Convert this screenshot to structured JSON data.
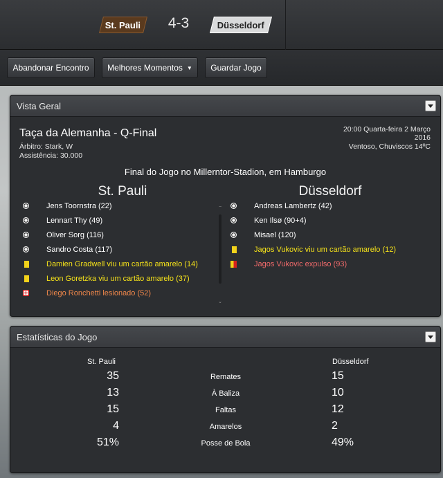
{
  "scoreboard": {
    "home_team": "St. Pauli",
    "score": "4-3",
    "away_team": "Düsseldorf",
    "home_color": "#5a3a1e",
    "away_color": "#d9dadb"
  },
  "toolbar": {
    "abandon_label": "Abandonar Encontro",
    "highlights_label": "Melhores Momentos",
    "save_label": "Guardar Jogo"
  },
  "overview": {
    "title": "Vista Geral",
    "competition": "Taça da Alemanha - Q-Final",
    "referee": "Árbitro: Stark, W",
    "attendance": "Assistência: 30.000",
    "kickoff": "20:00 Quarta-feira 2 Março",
    "year": "2016",
    "weather": "Ventoso, Chuviscos 14ºC",
    "venue": "Final do Jogo no Millerntor-Stadion, em Hamburgo",
    "home_team": "St. Pauli",
    "away_team": "Düsseldorf",
    "home_events": [
      {
        "type": "goal",
        "icon": "ball-icon",
        "text": "Jens Toornstra (22)"
      },
      {
        "type": "goal",
        "icon": "ball-icon",
        "text": "Lennart Thy (49)"
      },
      {
        "type": "goal",
        "icon": "ball-icon",
        "text": "Oliver Sorg (116)"
      },
      {
        "type": "goal",
        "icon": "ball-icon",
        "text": "Sandro Costa (117)"
      },
      {
        "type": "yellow",
        "icon": "yellow-card-icon",
        "text": "Damien Gradwell viu um cartão amarelo (14)"
      },
      {
        "type": "yellow",
        "icon": "yellow-card-icon",
        "text": "Leon Goretzka viu um cartão amarelo (37)"
      },
      {
        "type": "injury",
        "icon": "injury-icon",
        "text": "Diego Ronchetti lesionado (52)"
      }
    ],
    "away_events": [
      {
        "type": "goal",
        "icon": "ball-icon",
        "text": "Andreas Lambertz (42)"
      },
      {
        "type": "goal",
        "icon": "ball-icon",
        "text": "Ken Ilsø (90+4)"
      },
      {
        "type": "goal",
        "icon": "ball-icon",
        "text": "Misael (120)"
      },
      {
        "type": "yellow",
        "icon": "yellow-card-icon",
        "text": "Jagos Vukovic viu um cartão amarelo (12)"
      },
      {
        "type": "red",
        "icon": "second-yellow-red-card-icon",
        "text": "Jagos Vukovic expulso (93)"
      }
    ],
    "colors": {
      "yellow_text": "#f5e21a",
      "injury_text": "#f0874a",
      "red_text": "#f06a6a"
    }
  },
  "stats": {
    "title": "Estatísticas do Jogo",
    "home_team": "St. Pauli",
    "away_team": "Düsseldorf",
    "rows": [
      {
        "label": "Remates",
        "home": "35",
        "away": "15"
      },
      {
        "label": "À Baliza",
        "home": "13",
        "away": "10"
      },
      {
        "label": "Faltas",
        "home": "15",
        "away": "12"
      },
      {
        "label": "Amarelos",
        "home": "4",
        "away": "2"
      },
      {
        "label": "Posse de Bola",
        "home": "51%",
        "away": "49%"
      }
    ]
  }
}
